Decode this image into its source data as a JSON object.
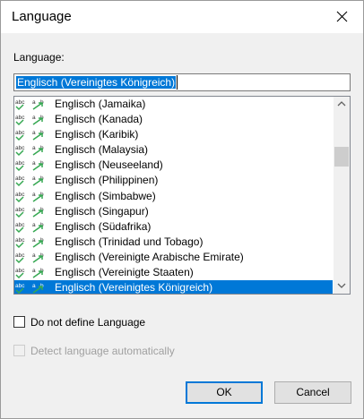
{
  "window": {
    "title": "Language"
  },
  "language_label": "Language:",
  "language_input": {
    "value": "Englisch (Vereinigtes Königreich)"
  },
  "language_list": {
    "items": [
      "Englisch (Jamaika)",
      "Englisch (Kanada)",
      "Englisch (Karibik)",
      "Englisch (Malaysia)",
      "Englisch (Neuseeland)",
      "Englisch (Philippinen)",
      "Englisch (Simbabwe)",
      "Englisch (Singapur)",
      "Englisch (Südafrika)",
      "Englisch (Trinidad und Tobago)",
      "Englisch (Vereinigte Arabische Emirate)",
      "Englisch (Vereinigte Staaten)",
      "Englisch (Vereinigtes Königreich)"
    ],
    "selected_index": 12,
    "item_icon": "spellcheck-abc-icon"
  },
  "options": {
    "do_not_define": {
      "label": "Do not define Language",
      "checked": false
    },
    "detect_auto": {
      "label": "Detect language automatically",
      "checked": false,
      "enabled": false
    }
  },
  "buttons": {
    "ok": "OK",
    "cancel": "Cancel"
  },
  "colors": {
    "selection": "#0078d7",
    "spell_icon": "#36a852"
  }
}
